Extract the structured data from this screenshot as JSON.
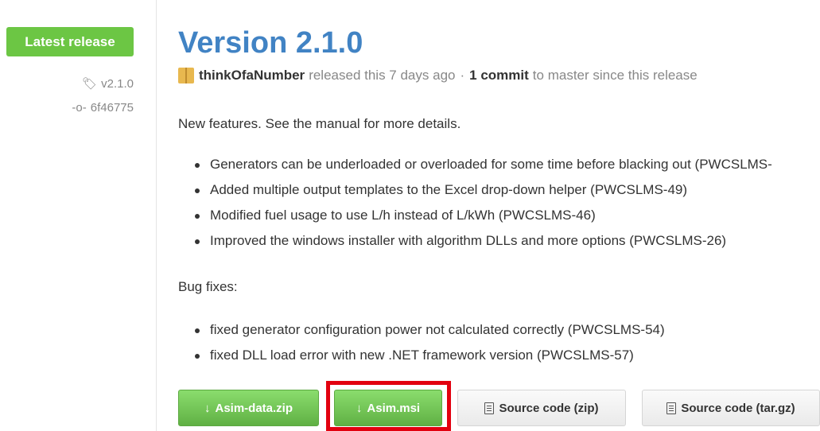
{
  "sidebar": {
    "badge": "Latest release",
    "tag": "v2.1.0",
    "commit": "6f46775"
  },
  "release": {
    "title": "Version 2.1.0",
    "author": "thinkOfaNumber",
    "released_text": "released this 7 days ago",
    "separator": "·",
    "commit_count": "1 commit",
    "commit_suffix": "to master since this release",
    "intro": "New features. See the manual for more details.",
    "features": [
      "Generators can be underloaded or overloaded for some time before blacking out (PWCSLMS-",
      "Added multiple output templates to the Excel drop-down helper (PWCSLMS-49)",
      "Modified fuel usage to use L/h instead of L/kWh (PWCSLMS-46)",
      "Improved the windows installer with algorithm DLLs and more options (PWCSLMS-26)"
    ],
    "bug_heading": "Bug fixes:",
    "bugs": [
      "fixed generator configuration power not calculated correctly (PWCSLMS-54)",
      "fixed DLL load error with new .NET framework version (PWCSLMS-57)"
    ]
  },
  "downloads": {
    "arrow": "↓",
    "asset1": "Asim-data.zip",
    "asset2": "Asim.msi",
    "source_zip": "Source code (zip)",
    "source_tar": "Source code (tar.gz)"
  },
  "icons": {
    "tag": "tag-icon",
    "commit": "commit-icon",
    "download": "download-arrow-icon",
    "file": "file-zip-icon"
  },
  "colors": {
    "badge_green": "#6cc644",
    "title_blue": "#4183c4",
    "highlight_red": "#e2000f"
  }
}
